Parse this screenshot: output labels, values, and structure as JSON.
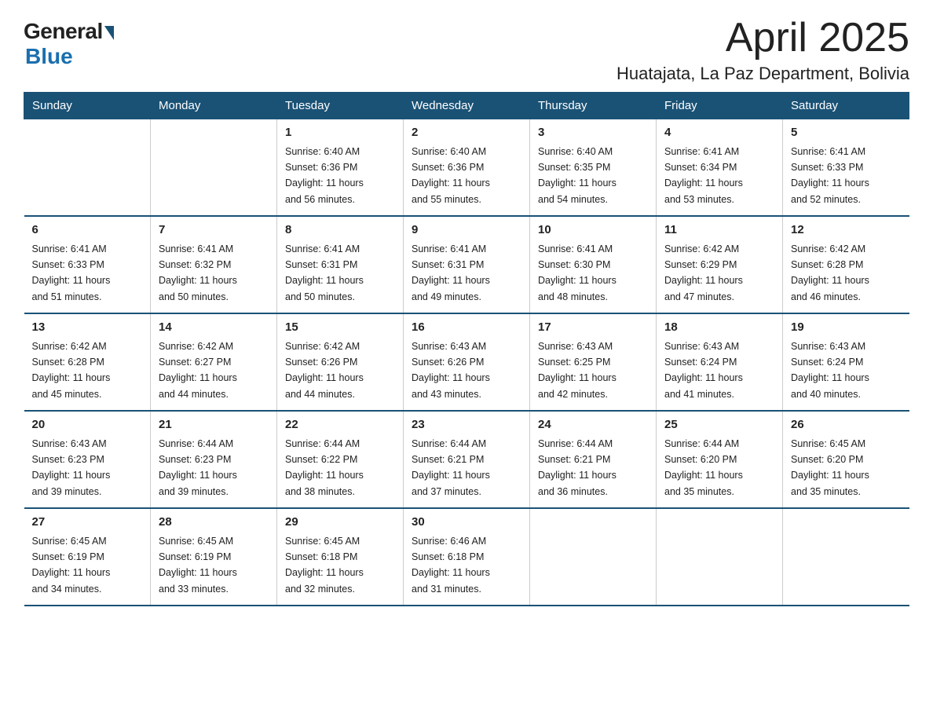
{
  "logo": {
    "general": "General",
    "blue": "Blue"
  },
  "title": "April 2025",
  "subtitle": "Huatajata, La Paz Department, Bolivia",
  "days_of_week": [
    "Sunday",
    "Monday",
    "Tuesday",
    "Wednesday",
    "Thursday",
    "Friday",
    "Saturday"
  ],
  "weeks": [
    [
      {
        "day": "",
        "info": ""
      },
      {
        "day": "",
        "info": ""
      },
      {
        "day": "1",
        "info": "Sunrise: 6:40 AM\nSunset: 6:36 PM\nDaylight: 11 hours\nand 56 minutes."
      },
      {
        "day": "2",
        "info": "Sunrise: 6:40 AM\nSunset: 6:36 PM\nDaylight: 11 hours\nand 55 minutes."
      },
      {
        "day": "3",
        "info": "Sunrise: 6:40 AM\nSunset: 6:35 PM\nDaylight: 11 hours\nand 54 minutes."
      },
      {
        "day": "4",
        "info": "Sunrise: 6:41 AM\nSunset: 6:34 PM\nDaylight: 11 hours\nand 53 minutes."
      },
      {
        "day": "5",
        "info": "Sunrise: 6:41 AM\nSunset: 6:33 PM\nDaylight: 11 hours\nand 52 minutes."
      }
    ],
    [
      {
        "day": "6",
        "info": "Sunrise: 6:41 AM\nSunset: 6:33 PM\nDaylight: 11 hours\nand 51 minutes."
      },
      {
        "day": "7",
        "info": "Sunrise: 6:41 AM\nSunset: 6:32 PM\nDaylight: 11 hours\nand 50 minutes."
      },
      {
        "day": "8",
        "info": "Sunrise: 6:41 AM\nSunset: 6:31 PM\nDaylight: 11 hours\nand 50 minutes."
      },
      {
        "day": "9",
        "info": "Sunrise: 6:41 AM\nSunset: 6:31 PM\nDaylight: 11 hours\nand 49 minutes."
      },
      {
        "day": "10",
        "info": "Sunrise: 6:41 AM\nSunset: 6:30 PM\nDaylight: 11 hours\nand 48 minutes."
      },
      {
        "day": "11",
        "info": "Sunrise: 6:42 AM\nSunset: 6:29 PM\nDaylight: 11 hours\nand 47 minutes."
      },
      {
        "day": "12",
        "info": "Sunrise: 6:42 AM\nSunset: 6:28 PM\nDaylight: 11 hours\nand 46 minutes."
      }
    ],
    [
      {
        "day": "13",
        "info": "Sunrise: 6:42 AM\nSunset: 6:28 PM\nDaylight: 11 hours\nand 45 minutes."
      },
      {
        "day": "14",
        "info": "Sunrise: 6:42 AM\nSunset: 6:27 PM\nDaylight: 11 hours\nand 44 minutes."
      },
      {
        "day": "15",
        "info": "Sunrise: 6:42 AM\nSunset: 6:26 PM\nDaylight: 11 hours\nand 44 minutes."
      },
      {
        "day": "16",
        "info": "Sunrise: 6:43 AM\nSunset: 6:26 PM\nDaylight: 11 hours\nand 43 minutes."
      },
      {
        "day": "17",
        "info": "Sunrise: 6:43 AM\nSunset: 6:25 PM\nDaylight: 11 hours\nand 42 minutes."
      },
      {
        "day": "18",
        "info": "Sunrise: 6:43 AM\nSunset: 6:24 PM\nDaylight: 11 hours\nand 41 minutes."
      },
      {
        "day": "19",
        "info": "Sunrise: 6:43 AM\nSunset: 6:24 PM\nDaylight: 11 hours\nand 40 minutes."
      }
    ],
    [
      {
        "day": "20",
        "info": "Sunrise: 6:43 AM\nSunset: 6:23 PM\nDaylight: 11 hours\nand 39 minutes."
      },
      {
        "day": "21",
        "info": "Sunrise: 6:44 AM\nSunset: 6:23 PM\nDaylight: 11 hours\nand 39 minutes."
      },
      {
        "day": "22",
        "info": "Sunrise: 6:44 AM\nSunset: 6:22 PM\nDaylight: 11 hours\nand 38 minutes."
      },
      {
        "day": "23",
        "info": "Sunrise: 6:44 AM\nSunset: 6:21 PM\nDaylight: 11 hours\nand 37 minutes."
      },
      {
        "day": "24",
        "info": "Sunrise: 6:44 AM\nSunset: 6:21 PM\nDaylight: 11 hours\nand 36 minutes."
      },
      {
        "day": "25",
        "info": "Sunrise: 6:44 AM\nSunset: 6:20 PM\nDaylight: 11 hours\nand 35 minutes."
      },
      {
        "day": "26",
        "info": "Sunrise: 6:45 AM\nSunset: 6:20 PM\nDaylight: 11 hours\nand 35 minutes."
      }
    ],
    [
      {
        "day": "27",
        "info": "Sunrise: 6:45 AM\nSunset: 6:19 PM\nDaylight: 11 hours\nand 34 minutes."
      },
      {
        "day": "28",
        "info": "Sunrise: 6:45 AM\nSunset: 6:19 PM\nDaylight: 11 hours\nand 33 minutes."
      },
      {
        "day": "29",
        "info": "Sunrise: 6:45 AM\nSunset: 6:18 PM\nDaylight: 11 hours\nand 32 minutes."
      },
      {
        "day": "30",
        "info": "Sunrise: 6:46 AM\nSunset: 6:18 PM\nDaylight: 11 hours\nand 31 minutes."
      },
      {
        "day": "",
        "info": ""
      },
      {
        "day": "",
        "info": ""
      },
      {
        "day": "",
        "info": ""
      }
    ]
  ]
}
